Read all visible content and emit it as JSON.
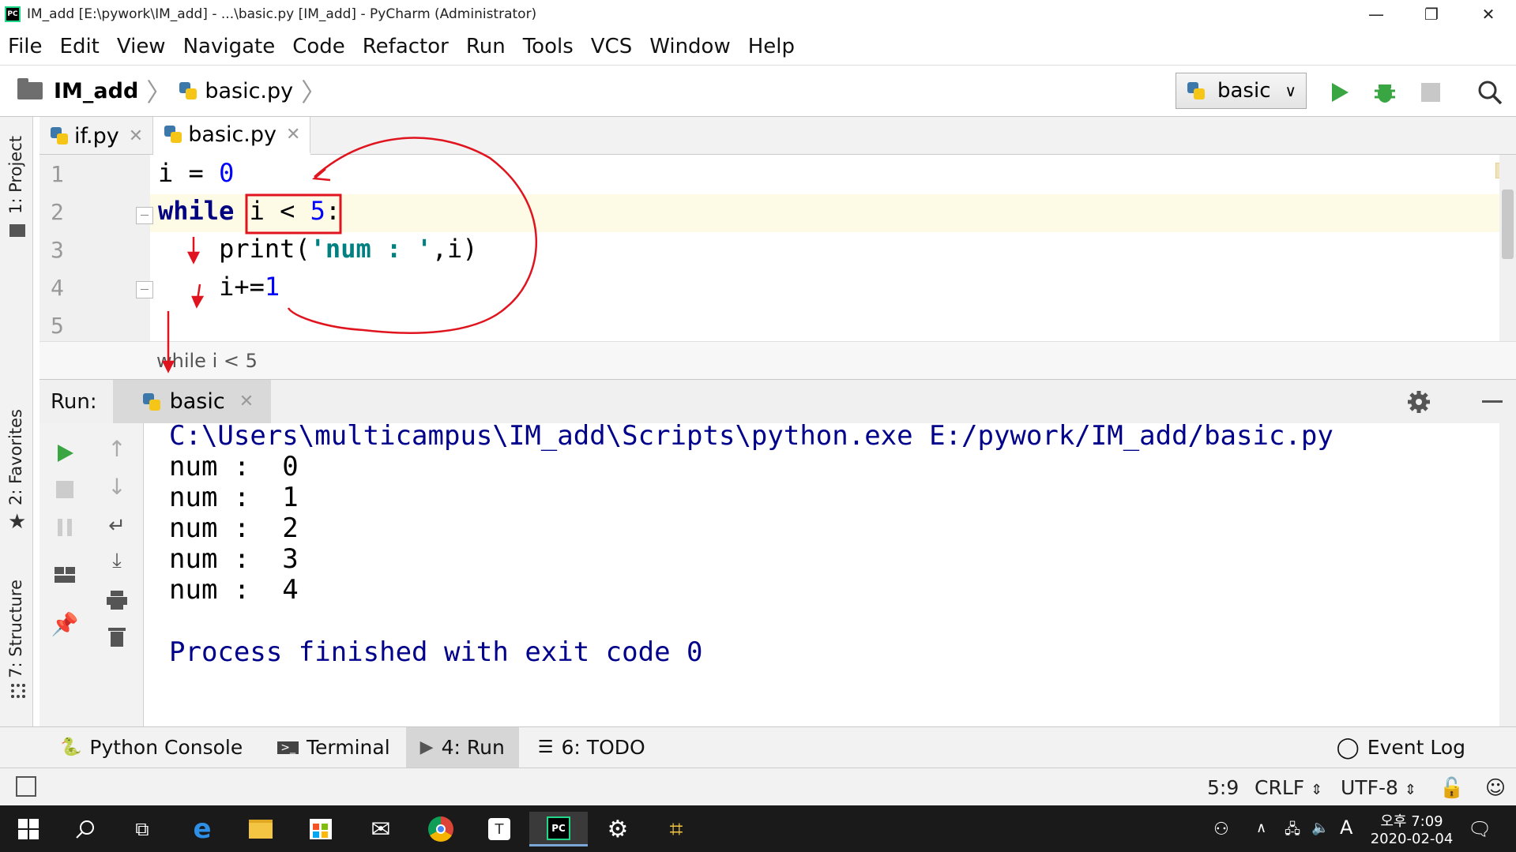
{
  "window": {
    "title": "IM_add [E:\\pywork\\IM_add] - ...\\basic.py [IM_add] - PyCharm (Administrator)",
    "logo_text": "PC",
    "minimize": "—",
    "restore": "❐",
    "close": "✕"
  },
  "menu": [
    "File",
    "Edit",
    "View",
    "Navigate",
    "Code",
    "Refactor",
    "Run",
    "Tools",
    "VCS",
    "Window",
    "Help"
  ],
  "nav": {
    "project": "IM_add",
    "file": "basic.py",
    "run_config": "basic"
  },
  "left_strip": {
    "project": "1: Project",
    "favorites": "2: Favorites",
    "structure": "7: Structure"
  },
  "editor_tabs": [
    {
      "label": "if.py",
      "active": false
    },
    {
      "label": "basic.py",
      "active": true
    }
  ],
  "editor": {
    "line_numbers": [
      "1",
      "2",
      "3",
      "4",
      "5"
    ],
    "lines": [
      {
        "parts": [
          [
            "",
            "i = "
          ],
          [
            "num",
            "0"
          ]
        ]
      },
      {
        "parts": [
          [
            "kw",
            "while"
          ],
          [
            "",
            " i < "
          ],
          [
            "num",
            "5"
          ],
          [
            "",
            ":"
          ]
        ]
      },
      {
        "parts": [
          [
            "",
            "    print("
          ],
          [
            "str",
            "'num : '"
          ],
          [
            "",
            ",i)"
          ]
        ]
      },
      {
        "parts": [
          [
            "",
            "    i+="
          ],
          [
            "num",
            "1"
          ]
        ]
      },
      {
        "parts": [
          [
            "",
            ""
          ]
        ]
      }
    ],
    "breadcrumb": "while i < 5"
  },
  "run": {
    "title": "Run:",
    "tab": "basic",
    "output": [
      "C:\\Users\\multicampus\\IM_add\\Scripts\\python.exe E:/pywork/IM_add/basic.py",
      "num :  0",
      "num :  1",
      "num :  2",
      "num :  3",
      "num :  4",
      "",
      "Process finished with exit code 0"
    ]
  },
  "bottom_tabs": {
    "python_console": "Python Console",
    "terminal": "Terminal",
    "run": "4: Run",
    "todo": "6: TODO",
    "event_log": "Event Log"
  },
  "status": {
    "position": "5:9",
    "line_sep": "CRLF",
    "encoding": "UTF-8"
  },
  "taskbar": {
    "ampm_time": "오후 7:09",
    "date": "2020-02-04",
    "ime": "A"
  },
  "colors": {
    "keyword": "#000080",
    "number": "#0000ff",
    "string": "#008080",
    "console_blue": "#00008b",
    "annotation_red": "#e0141e"
  }
}
